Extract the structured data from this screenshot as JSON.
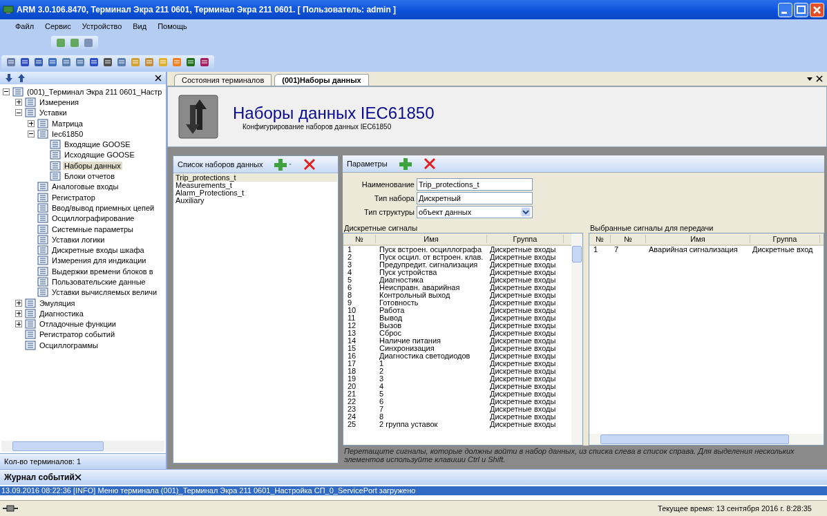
{
  "window": {
    "title": "ARM 3.0.106.8470, Терминал Экра 211 0601, Терминал Экра 211 0601. [ Пользователь: admin ]"
  },
  "menu": [
    "Файл",
    "Сервис",
    "Устройство",
    "Вид",
    "Помощь"
  ],
  "tree": {
    "count_label": "Кол-во терминалов: 1",
    "nodes": [
      {
        "label": "(001)_Терминал Экра 211 0601_Настр",
        "expanded": true,
        "selected": false,
        "children": [
          {
            "label": "Измерения",
            "expanded": false,
            "selected": false
          },
          {
            "label": "Уставки",
            "expanded": true,
            "selected": false,
            "children": [
              {
                "label": "Матрица",
                "expanded": false,
                "selected": false
              },
              {
                "label": "Iec61850",
                "expanded": true,
                "selected": false,
                "children": [
                  {
                    "label": "Входящие GOOSE",
                    "selected": false
                  },
                  {
                    "label": "Исходящие GOOSE",
                    "selected": false
                  },
                  {
                    "label": "Наборы данных",
                    "selected": true
                  },
                  {
                    "label": "Блоки отчетов",
                    "selected": false
                  }
                ]
              },
              {
                "label": "Аналоговые входы",
                "selected": false
              },
              {
                "label": "Регистратор",
                "selected": false
              },
              {
                "label": "Ввод/вывод приемных цепей",
                "selected": false
              },
              {
                "label": "Осциллографирование",
                "selected": false
              },
              {
                "label": "Системные параметры",
                "selected": false
              },
              {
                "label": "Уставки логики",
                "selected": false
              },
              {
                "label": "Дискретные входы шкафа",
                "selected": false
              },
              {
                "label": "Измерения для индикации",
                "selected": false
              },
              {
                "label": "Выдержки времени блоков в",
                "selected": false
              },
              {
                "label": "Пользовательские данные",
                "selected": false
              },
              {
                "label": "Уставки вычисляемых величи",
                "selected": false
              }
            ]
          },
          {
            "label": "Эмуляция",
            "expanded": false,
            "selected": false
          },
          {
            "label": "Диагностика",
            "expanded": false,
            "selected": false
          },
          {
            "label": "Отладочные функции",
            "expanded": false,
            "selected": false
          },
          {
            "label": "Регистратор событий",
            "selected": false
          },
          {
            "label": "Осциллограммы",
            "selected": false
          }
        ]
      }
    ]
  },
  "tabs": [
    {
      "label": "Состояния терминалов",
      "selected": false
    },
    {
      "label": "(001)Наборы данных",
      "selected": true
    }
  ],
  "header": {
    "title": "Наборы данных IEC61850",
    "subtitle": "Конфигурирование наборов данных IEC61850"
  },
  "datasets": {
    "title": "Список наборов данных",
    "items": [
      {
        "label": "Trip_protections_t",
        "selected": true
      },
      {
        "label": "Measurements_t",
        "selected": false
      },
      {
        "label": "Alarm_Protections_t",
        "selected": false
      },
      {
        "label": "Auxiliary",
        "selected": false
      }
    ]
  },
  "parameters": {
    "title": "Параметры",
    "fields": [
      {
        "label": "Наименование",
        "value": "Trip_protections_t",
        "kind": "text"
      },
      {
        "label": "Тип набора",
        "value": "Дискретный",
        "kind": "text"
      },
      {
        "label": "Тип структуры",
        "value": "объект данных",
        "kind": "select"
      }
    ]
  },
  "signals": {
    "title": "Дискретные сигналы",
    "columns": [
      "№",
      "Имя",
      "Группа"
    ],
    "rows": [
      [
        "1",
        "Пуск встроен. осциллографа",
        "Дискретные входы"
      ],
      [
        "2",
        "Пуск осцил. от встроен. клав.",
        "Дискретные входы"
      ],
      [
        "3",
        "Предупредит. сигнализация",
        "Дискретные входы"
      ],
      [
        "4",
        "Пуск устройства",
        "Дискретные входы"
      ],
      [
        "5",
        "Диагностика",
        "Дискретные входы"
      ],
      [
        "6",
        "Неисправн. аварийная",
        "Дискретные входы"
      ],
      [
        "8",
        "Контрольный выход",
        "Дискретные входы"
      ],
      [
        "9",
        "Готовность",
        "Дискретные входы"
      ],
      [
        "10",
        "Работа",
        "Дискретные входы"
      ],
      [
        "11",
        "Вывод",
        "Дискретные входы"
      ],
      [
        "12",
        "Вызов",
        "Дискретные входы"
      ],
      [
        "13",
        "Сброс",
        "Дискретные входы"
      ],
      [
        "14",
        "Наличие питания",
        "Дискретные входы"
      ],
      [
        "15",
        "Синхронизация",
        "Дискретные входы"
      ],
      [
        "16",
        "Диагностика светодиодов",
        "Дискретные входы"
      ],
      [
        "17",
        "1",
        "Дискретные входы"
      ],
      [
        "18",
        "2",
        "Дискретные входы"
      ],
      [
        "19",
        "3",
        "Дискретные входы"
      ],
      [
        "20",
        "4",
        "Дискретные входы"
      ],
      [
        "21",
        "5",
        "Дискретные входы"
      ],
      [
        "22",
        "6",
        "Дискретные входы"
      ],
      [
        "23",
        "7",
        "Дискретные входы"
      ],
      [
        "24",
        "8",
        "Дискретные входы"
      ],
      [
        "25",
        "2 группа уставок",
        "Дискретные входы"
      ]
    ]
  },
  "selected_signals": {
    "title": "Выбранные сигналы для передачи",
    "columns": [
      "№",
      "№",
      "Имя",
      "Группа"
    ],
    "rows": [
      [
        "1",
        "7",
        "Аварийная сигнализация",
        "Дискретные вход"
      ]
    ]
  },
  "hint": "Перетащите сигналы, которые должны войти в набор данных, из списка слева в список справа. Для выделения нескольких элементов используйте клавиши Ctrl и Shift.",
  "event_log": {
    "title": "Журнал событий",
    "entries": [
      {
        "text": "13.09.2016 08:22:36 [INFO] Меню терминала (001)_Терминал Экра 211 0601_Настройка СП_0_ServicePort загружено",
        "selected": true
      }
    ]
  },
  "status_bar": {
    "time": "Текущее время: 13 сентября 2016 г. 8:28:35"
  }
}
